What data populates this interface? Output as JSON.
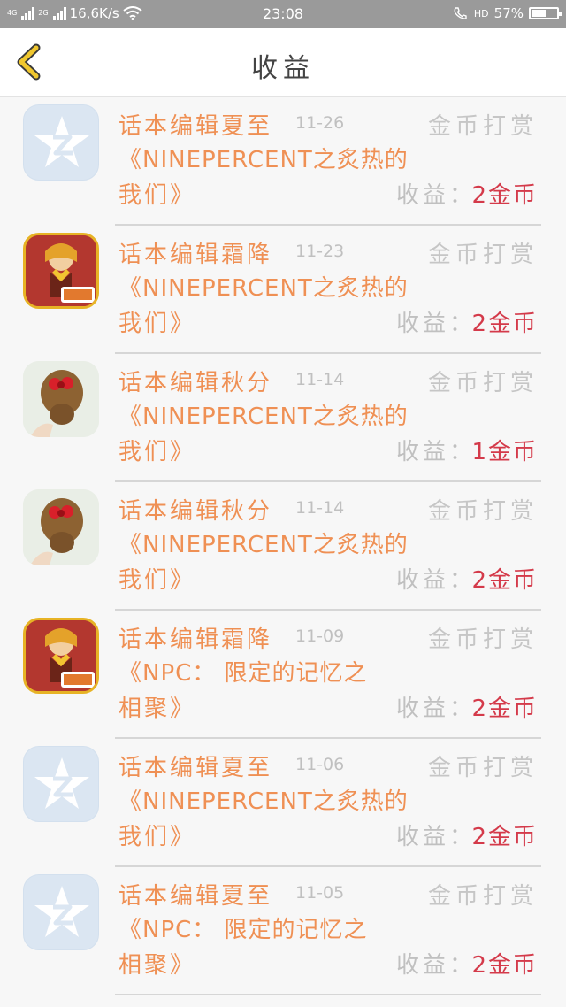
{
  "status_bar": {
    "network_left": "4G",
    "network_right": "2G",
    "speed": "16,6K/s",
    "time": "23:08",
    "hd_label": "HD",
    "battery": "57%",
    "battery_level": 0.57,
    "icons": [
      "signal-icon",
      "wifi-icon",
      "call-icon",
      "battery-icon"
    ]
  },
  "header": {
    "title": "收益",
    "back_icon": "chevron-left-icon",
    "back_color": "#f0c72e"
  },
  "colors": {
    "title_orange": "#ef9054",
    "earn_red": "#d43a4a",
    "muted_gray": "#c0c0c0"
  },
  "items": [
    {
      "avatar": "qq-star",
      "editor": "话本编辑夏至",
      "date": "11-26",
      "reward_type": "金币打赏",
      "desc1": "《NINEPERCENT之炙热的",
      "desc2": "我们》",
      "earn_label": "收益：",
      "earn_value": "2金币"
    },
    {
      "avatar": "anime",
      "editor": "话本编辑霜降",
      "date": "11-23",
      "reward_type": "金币打赏",
      "desc1": "《NINEPERCENT之炙热的",
      "desc2": "我们》",
      "earn_label": "收益：",
      "earn_value": "2金币"
    },
    {
      "avatar": "hair",
      "editor": "话本编辑秋分",
      "date": "11-14",
      "reward_type": "金币打赏",
      "desc1": "《NINEPERCENT之炙热的",
      "desc2": "我们》",
      "earn_label": "收益：",
      "earn_value": "1金币"
    },
    {
      "avatar": "hair",
      "editor": "话本编辑秋分",
      "date": "11-14",
      "reward_type": "金币打赏",
      "desc1": "《NINEPERCENT之炙热的",
      "desc2": "我们》",
      "earn_label": "收益：",
      "earn_value": "2金币"
    },
    {
      "avatar": "anime",
      "editor": "话本编辑霜降",
      "date": "11-09",
      "reward_type": "金币打赏",
      "desc1": "《NPC：  限定的记忆之",
      "desc2": "相聚》",
      "earn_label": "收益：",
      "earn_value": "2金币"
    },
    {
      "avatar": "qq-star",
      "editor": "话本编辑夏至",
      "date": "11-06",
      "reward_type": "金币打赏",
      "desc1": "《NINEPERCENT之炙热的",
      "desc2": "我们》",
      "earn_label": "收益：",
      "earn_value": "2金币"
    },
    {
      "avatar": "qq-star",
      "editor": "话本编辑夏至",
      "date": "11-05",
      "reward_type": "金币打赏",
      "desc1": "《NPC：  限定的记忆之",
      "desc2": "相聚》",
      "earn_label": "收益：",
      "earn_value": "2金币"
    }
  ]
}
